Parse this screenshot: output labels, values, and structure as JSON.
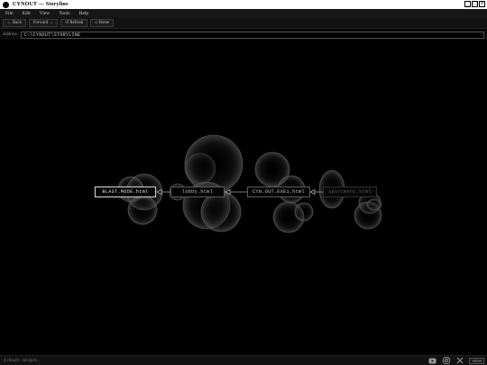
{
  "window": {
    "title": "CYNOUT — Storyline"
  },
  "menu": {
    "items": [
      "File",
      "Edit",
      "View",
      "Tools",
      "Help"
    ]
  },
  "toolbar": {
    "back": "← Back",
    "forward": "Forward →",
    "refresh": "↺ Refresh",
    "home": "⌂ Home"
  },
  "address": {
    "label": "Address",
    "value": "C:\\CYNOUT\\STORYLINE"
  },
  "nodes": [
    {
      "label": "BLAST.MODE.html",
      "state": "active"
    },
    {
      "label": "lobby.html",
      "state": "normal"
    },
    {
      "label": "CYN.OUT.EXE1.html",
      "state": "normal"
    },
    {
      "label": "apartment.html",
      "state": "dim"
    }
  ],
  "status": {
    "text": "4 chosen · navigate...",
    "view_label": "VIEW"
  },
  "colors": {
    "background": "#000000",
    "titlebar": "#ffffff",
    "accent": "#cfcfcf"
  },
  "icons": [
    "youtube-icon",
    "instagram-icon",
    "x-icon"
  ]
}
